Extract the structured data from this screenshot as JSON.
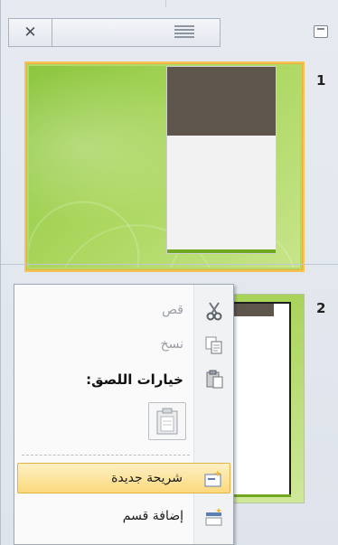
{
  "pane": {
    "tabs": [
      {
        "icon": "close-icon"
      },
      {
        "icon": "outline-icon"
      }
    ],
    "minimize_icon": "minimize-icon"
  },
  "slides": [
    {
      "number": "1",
      "selected": true
    },
    {
      "number": "2",
      "selected": false
    }
  ],
  "context_menu": {
    "items": [
      {
        "label": "قص",
        "icon": "scissors-icon",
        "enabled": false
      },
      {
        "label": "نسخ",
        "icon": "copy-icon",
        "enabled": false
      },
      {
        "label": "خيارات اللصق:",
        "icon": "clipboard-icon",
        "enabled": true,
        "heading": true
      },
      {
        "label": "شريحة جديدة",
        "icon": "new-slide-icon",
        "enabled": true,
        "highlighted": true
      },
      {
        "label": "إضافة قسم",
        "icon": "add-section-icon",
        "enabled": true
      }
    ],
    "paste_option_icon": "paste-keep-text-icon"
  },
  "colors": {
    "highlight": "#fbd97c",
    "slide_green": "#8cc63f",
    "band_brown": "#5e554c"
  }
}
